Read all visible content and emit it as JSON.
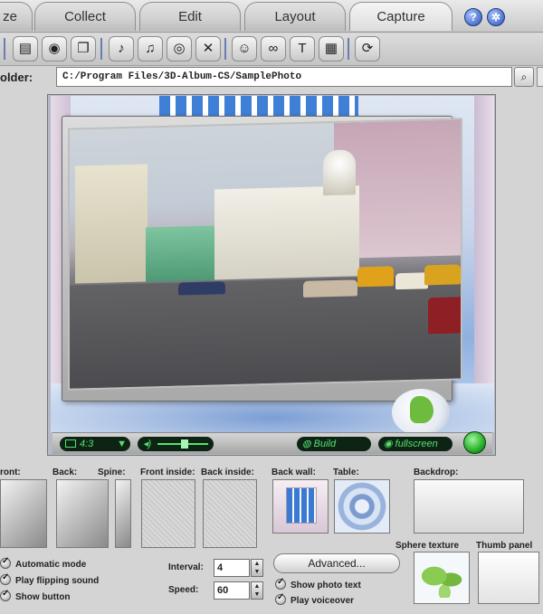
{
  "tabs": [
    {
      "label": "ze"
    },
    {
      "label": "Collect"
    },
    {
      "label": "Edit"
    },
    {
      "label": "Layout"
    },
    {
      "label": "Capture"
    }
  ],
  "help_icons": [
    "help-icon",
    "about-icon"
  ],
  "toolbar": {
    "icons": [
      "open-album-icon",
      "add-photos-icon",
      "open-folder-icon",
      "add-music-icon",
      "music-list-icon",
      "cd-audio-icon",
      "remove-music-icon",
      "user-icon",
      "link-icon",
      "text-icon",
      "film-icon",
      "publish-icon"
    ]
  },
  "folder": {
    "label": "older:",
    "path": "C:/Program  Files/3D-Album-CS/SamplePhoto"
  },
  "preview": {
    "page_ratio": "4:3",
    "build_label": "Build",
    "fullscreen_label": "fullscreen",
    "colors": {
      "lcd_text": "#55e06f",
      "go_button": "#15a21a"
    }
  },
  "textures": {
    "front": "ront:",
    "back": "Back:",
    "spine": "Spine:",
    "front_inside": "Front inside:",
    "back_inside": "Back inside:",
    "back_wall": "Back wall:",
    "table": "Table:",
    "backdrop": "Backdrop:",
    "sphere_texture": "Sphere texture",
    "thumb_panel": "Thumb panel"
  },
  "options": {
    "automatic_mode": "Automatic mode",
    "play_flipping_sound": "Play flipping sound",
    "show_button": "Show button",
    "interval_label": "Interval:",
    "interval_value": "4",
    "speed_label": "Speed:",
    "speed_value": "60",
    "advanced_label": "Advanced...",
    "show_photo_text": "Show photo text",
    "play_voiceover": "Play voiceover"
  }
}
